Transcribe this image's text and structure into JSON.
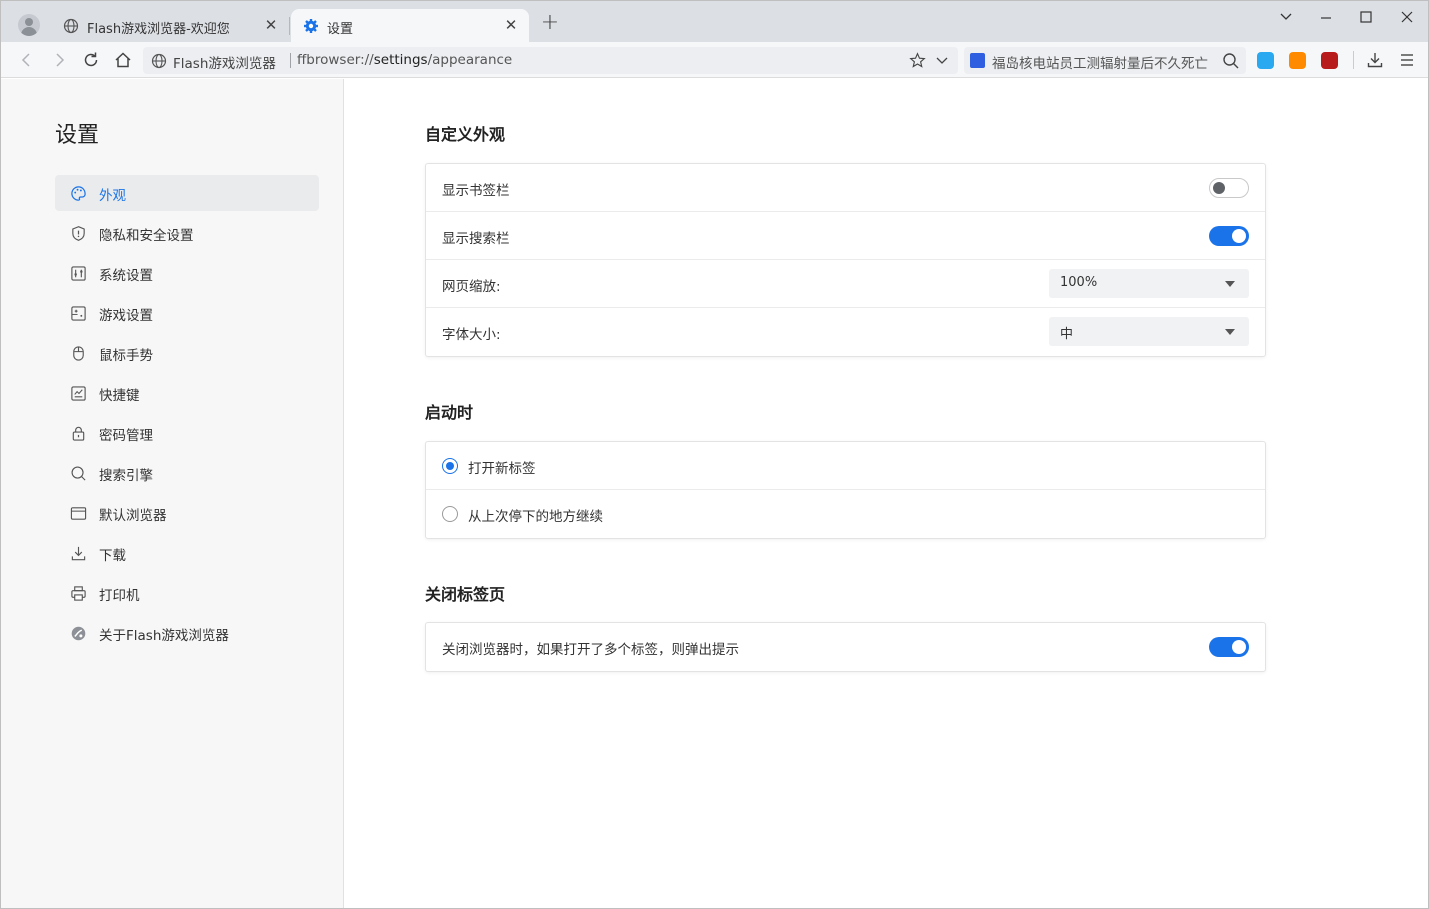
{
  "tabs": [
    {
      "title": "Flash游戏浏览器-欢迎您",
      "icon": "globe-icon",
      "active": false
    },
    {
      "title": "设置",
      "icon": "gear-icon",
      "active": true
    }
  ],
  "toolbar": {
    "site_name": "Flash游戏浏览器",
    "url_scheme": "ffbrowser://",
    "url_host": "settings",
    "url_path": "/appearance",
    "search_text": "福岛核电站员工测辐射量后不久死亡"
  },
  "colors": {
    "accent": "#1a73e8",
    "ext1": "#2aa8f0",
    "ext2": "#ff8a00",
    "ext3": "#b81b1b"
  },
  "sidebar": {
    "title": "设置",
    "items": [
      {
        "label": "外观",
        "icon": "palette-icon",
        "selected": true
      },
      {
        "label": "隐私和安全设置",
        "icon": "shield-icon"
      },
      {
        "label": "系统设置",
        "icon": "system-icon"
      },
      {
        "label": "游戏设置",
        "icon": "gamepad-icon"
      },
      {
        "label": "鼠标手势",
        "icon": "mouse-icon"
      },
      {
        "label": "快捷键",
        "icon": "keyboard-icon"
      },
      {
        "label": "密码管理",
        "icon": "lock-icon"
      },
      {
        "label": "搜索引擎",
        "icon": "search-icon"
      },
      {
        "label": "默认浏览器",
        "icon": "browser-window-icon"
      },
      {
        "label": "下载",
        "icon": "download-icon"
      },
      {
        "label": "打印机",
        "icon": "printer-icon"
      },
      {
        "label": "关于Flash游戏浏览器",
        "icon": "about-logo-icon"
      }
    ]
  },
  "appearance": {
    "title": "自定义外观",
    "show_bookmarks": {
      "label": "显示书签栏",
      "on": false
    },
    "show_search": {
      "label": "显示搜索栏",
      "on": true
    },
    "zoom": {
      "label": "网页缩放:",
      "value": "100%"
    },
    "font_size": {
      "label": "字体大小:",
      "value": "中"
    }
  },
  "startup": {
    "title": "启动时",
    "options": [
      {
        "label": "打开新标签",
        "checked": true
      },
      {
        "label": "从上次停下的地方继续",
        "checked": false
      }
    ]
  },
  "close_tabs": {
    "title": "关闭标签页",
    "prompt": {
      "label": "关闭浏览器时，如果打开了多个标签，则弹出提示",
      "on": true
    }
  }
}
